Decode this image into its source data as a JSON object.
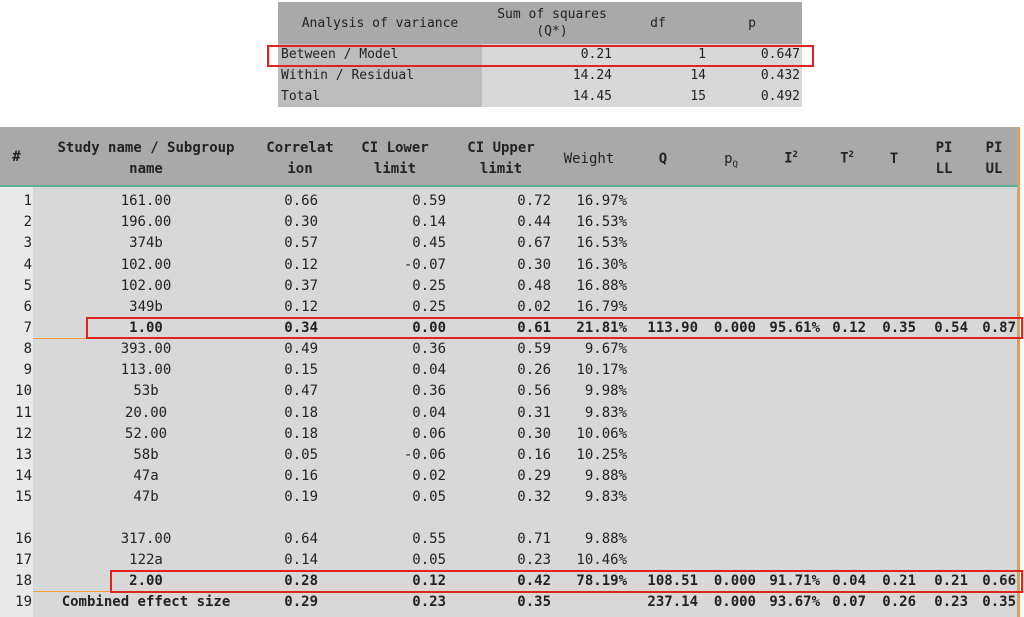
{
  "anova": {
    "headers": {
      "label": "Analysis of variance",
      "ss": "Sum of squares",
      "ss_sub": "(Q*)",
      "df": "df",
      "p": "p"
    },
    "rows": [
      {
        "label": "Between / Model",
        "ss": "0.21",
        "df": "1",
        "p": "0.647"
      },
      {
        "label": "Within / Residual",
        "ss": "14.24",
        "df": "14",
        "p": "0.432"
      },
      {
        "label": "Total",
        "ss": "14.45",
        "df": "15",
        "p": "0.492"
      }
    ]
  },
  "table": {
    "headers": {
      "num": "#",
      "name1": "Study name / Subgroup",
      "name2": "name",
      "corr1": "Correlat",
      "corr2": "ion",
      "lo1": "CI Lower",
      "lo2": "limit",
      "up1": "CI Upper",
      "up2": "limit",
      "w": "Weight",
      "q": "Q",
      "p": "p",
      "p_sub": "Q",
      "i": "I",
      "i_sup": "2",
      "t2": "T",
      "t2_sup": "2",
      "t": "T",
      "pll1": "PI",
      "pll2": "LL",
      "pul1": "PI",
      "pul2": "UL"
    },
    "rows": [
      {
        "num": "1",
        "name": "161.00",
        "corr": "0.66",
        "lo": "0.59",
        "up": "0.72",
        "w": "16.97%"
      },
      {
        "num": "2",
        "name": "196.00",
        "corr": "0.30",
        "lo": "0.14",
        "up": "0.44",
        "w": "16.53%"
      },
      {
        "num": "3",
        "name": "374b",
        "corr": "0.57",
        "lo": "0.45",
        "up": "0.67",
        "w": "16.53%"
      },
      {
        "num": "4",
        "name": "102.00",
        "corr": "0.12",
        "lo": "-0.07",
        "up": "0.30",
        "w": "16.30%"
      },
      {
        "num": "5",
        "name": "102.00",
        "corr": "0.37",
        "lo": "0.25",
        "up": "0.48",
        "w": "16.88%"
      },
      {
        "num": "6",
        "name": "349b",
        "corr": "0.12",
        "lo": "0.25",
        "up": "0.02",
        "w": "16.79%"
      },
      {
        "num": "7",
        "name": "1.00",
        "corr": "0.34",
        "lo": "0.00",
        "up": "0.61",
        "w": "21.81%",
        "q": "113.90",
        "p": "0.000",
        "i2": "95.61%",
        "t2": "0.12",
        "t": "0.35",
        "pll": "0.54",
        "pul": "0.87"
      },
      {
        "num": "8",
        "name": "393.00",
        "corr": "0.49",
        "lo": "0.36",
        "up": "0.59",
        "w": "9.67%"
      },
      {
        "num": "9",
        "name": "113.00",
        "corr": "0.15",
        "lo": "0.04",
        "up": "0.26",
        "w": "10.17%"
      },
      {
        "num": "10",
        "name": "53b",
        "corr": "0.47",
        "lo": "0.36",
        "up": "0.56",
        "w": "9.98%"
      },
      {
        "num": "11",
        "name": "20.00",
        "corr": "0.18",
        "lo": "0.04",
        "up": "0.31",
        "w": "9.83%"
      },
      {
        "num": "12",
        "name": "52.00",
        "corr": "0.18",
        "lo": "0.06",
        "up": "0.30",
        "w": "10.06%"
      },
      {
        "num": "13",
        "name": "58b",
        "corr": "0.05",
        "lo": "-0.06",
        "up": "0.16",
        "w": "10.25%"
      },
      {
        "num": "14",
        "name": "47a",
        "corr": "0.16",
        "lo": "0.02",
        "up": "0.29",
        "w": "9.88%"
      },
      {
        "num": "15",
        "name": "47b",
        "corr": "0.19",
        "lo": "0.05",
        "up": "0.32",
        "w": "9.83%"
      },
      {
        "num": "16",
        "name": "317.00",
        "corr": "0.64",
        "lo": "0.55",
        "up": "0.71",
        "w": "9.88%"
      },
      {
        "num": "17",
        "name": "122a",
        "corr": "0.14",
        "lo": "0.05",
        "up": "0.23",
        "w": "10.46%"
      },
      {
        "num": "18",
        "name": "2.00",
        "corr": "0.28",
        "lo": "0.12",
        "up": "0.42",
        "w": "78.19%",
        "q": "108.51",
        "p": "0.000",
        "i2": "91.71%",
        "t2": "0.04",
        "t": "0.21",
        "pll": "0.21",
        "pul": "0.66"
      },
      {
        "num": "19",
        "name": "Combined effect size",
        "corr": "0.29",
        "lo": "0.23",
        "up": "0.35",
        "w": "",
        "q": "237.14",
        "p": "0.000",
        "i2": "93.67%",
        "t2": "0.07",
        "t": "0.26",
        "pll": "0.23",
        "pul": "0.35"
      }
    ]
  },
  "colors": {
    "highlight": "#e0231c",
    "accent": "#f29b38",
    "header": "#a9a9a9",
    "cell": "#d8d8d8"
  }
}
